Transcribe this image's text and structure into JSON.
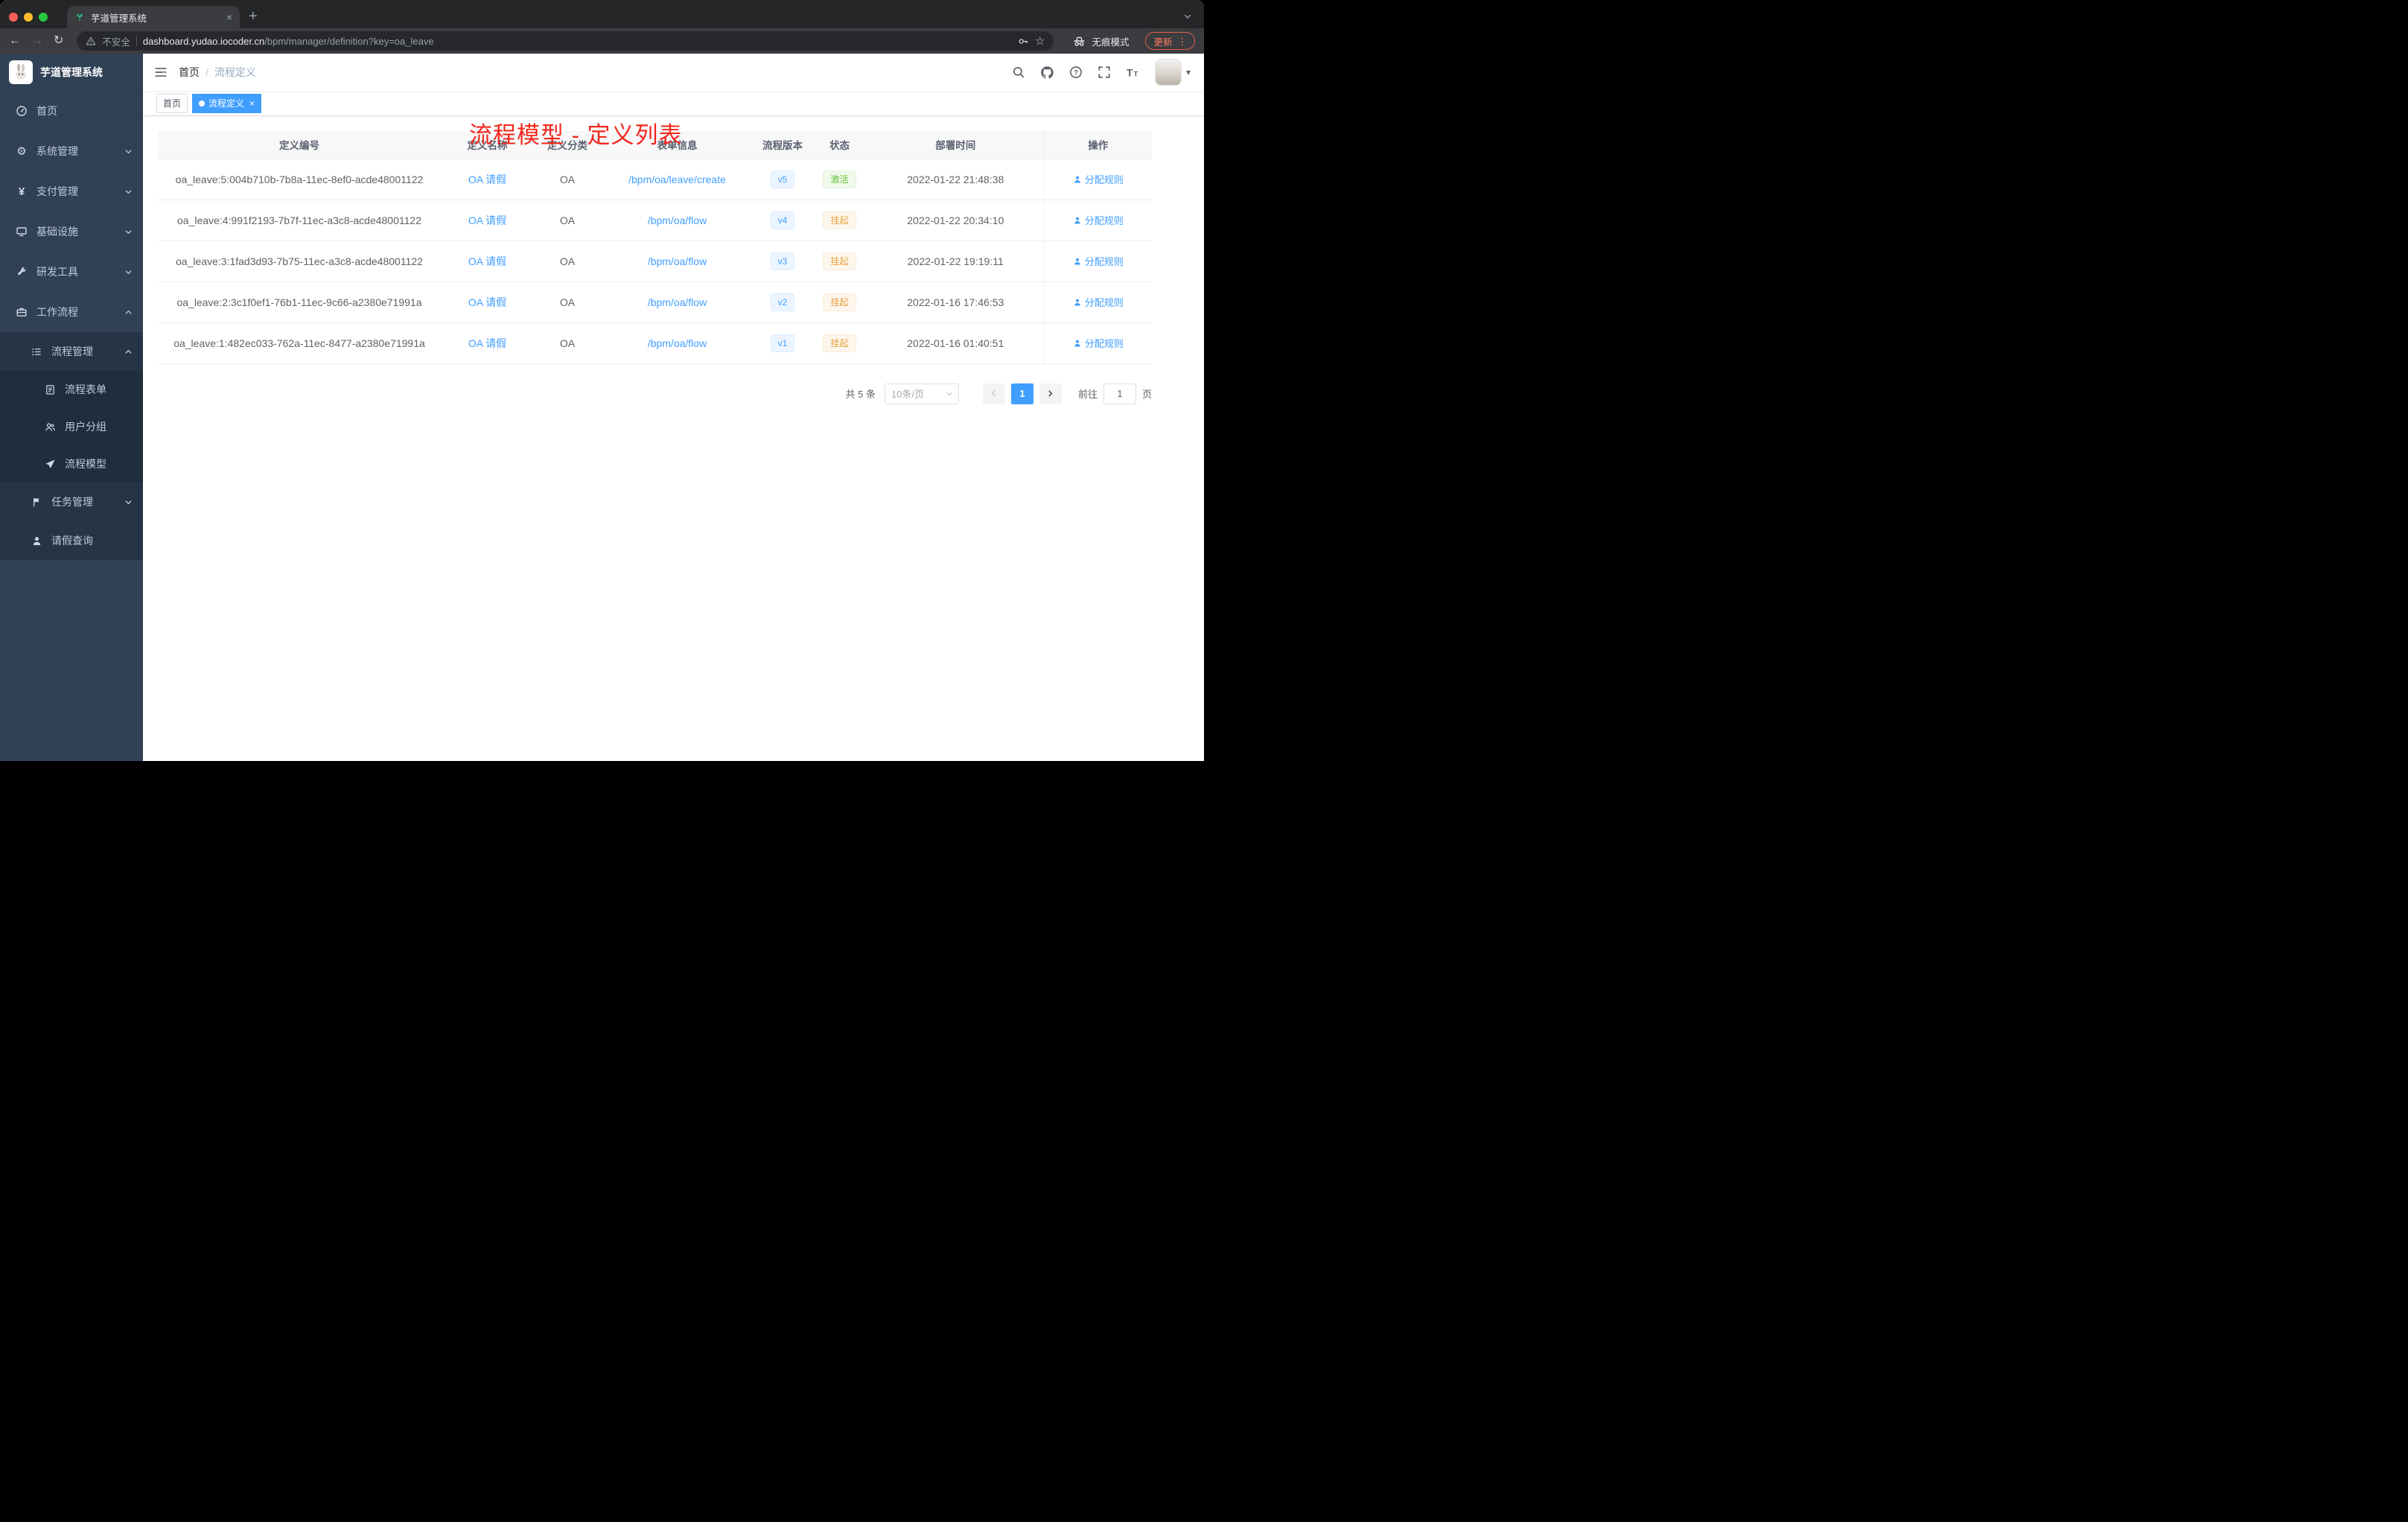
{
  "browser": {
    "tab_title": "芋道管理系统",
    "security_label": "不安全",
    "url_host": "dashboard.yudao.iocoder.cn",
    "url_path": "/bpm/manager/definition?key=oa_leave",
    "incognito_label": "无痕模式",
    "update_label": "更新"
  },
  "sidebar": {
    "logo_title": "芋道管理系统",
    "items": [
      {
        "label": "首页",
        "icon": "dashboard-icon"
      },
      {
        "label": "系统管理",
        "icon": "gear-icon"
      },
      {
        "label": "支付管理",
        "icon": "yen-icon"
      },
      {
        "label": "基础设施",
        "icon": "monitor-icon"
      },
      {
        "label": "研发工具",
        "icon": "wrench-icon"
      },
      {
        "label": "工作流程",
        "icon": "briefcase-icon"
      },
      {
        "label": "流程管理",
        "icon": "list-icon"
      },
      {
        "label": "流程表单",
        "icon": "document-icon"
      },
      {
        "label": "用户分组",
        "icon": "users-icon"
      },
      {
        "label": "流程模型",
        "icon": "paper-plane-icon"
      },
      {
        "label": "任务管理",
        "icon": "flag-icon"
      },
      {
        "label": "请假查询",
        "icon": "user-icon"
      }
    ]
  },
  "header": {
    "breadcrumb_home": "首页",
    "breadcrumb_current": "流程定义"
  },
  "annotation": {
    "text": "流程模型 - 定义列表",
    "color": "#f2271c"
  },
  "tags": [
    {
      "label": "首页",
      "active": false
    },
    {
      "label": "流程定义",
      "active": true
    }
  ],
  "table": {
    "columns": [
      "定义编号",
      "定义名称",
      "定义分类",
      "表单信息",
      "流程版本",
      "状态",
      "部署时间",
      "操作"
    ],
    "rows": [
      {
        "id": "oa_leave:5:004b710b-7b8a-11ec-8ef0-acde48001122",
        "name": "OA 请假",
        "category": "OA",
        "form": "/bpm/oa/leave/create",
        "version": "v5",
        "status": "激活",
        "status_type": "success",
        "time": "2022-01-22 21:48:38",
        "action": "分配规则"
      },
      {
        "id": "oa_leave:4:991f2193-7b7f-11ec-a3c8-acde48001122",
        "name": "OA 请假",
        "category": "OA",
        "form": "/bpm/oa/flow",
        "version": "v4",
        "status": "挂起",
        "status_type": "warning",
        "time": "2022-01-22 20:34:10",
        "action": "分配规则"
      },
      {
        "id": "oa_leave:3:1fad3d93-7b75-11ec-a3c8-acde48001122",
        "name": "OA 请假",
        "category": "OA",
        "form": "/bpm/oa/flow",
        "version": "v3",
        "status": "挂起",
        "status_type": "warning",
        "time": "2022-01-22 19:19:11",
        "action": "分配规则"
      },
      {
        "id": "oa_leave:2:3c1f0ef1-76b1-11ec-9c66-a2380e71991a",
        "name": "OA 请假",
        "category": "OA",
        "form": "/bpm/oa/flow",
        "version": "v2",
        "status": "挂起",
        "status_type": "warning",
        "time": "2022-01-16 17:46:53",
        "action": "分配规则"
      },
      {
        "id": "oa_leave:1:482ec033-762a-11ec-8477-a2380e71991a",
        "name": "OA 请假",
        "category": "OA",
        "form": "/bpm/oa/flow",
        "version": "v1",
        "status": "挂起",
        "status_type": "warning",
        "time": "2022-01-16 01:40:51",
        "action": "分配规则"
      }
    ]
  },
  "pagination": {
    "total": "共 5 条",
    "page_size": "10条/页",
    "current_page": "1",
    "goto_label": "前往",
    "goto_value": "1",
    "page_unit": "页"
  },
  "colors": {
    "accent_blue": "#409eff",
    "status_active": "#67c23a",
    "status_suspended": "#e6a23c",
    "sidebar_bg": "#304156",
    "annotation_red": "#f2271c"
  }
}
